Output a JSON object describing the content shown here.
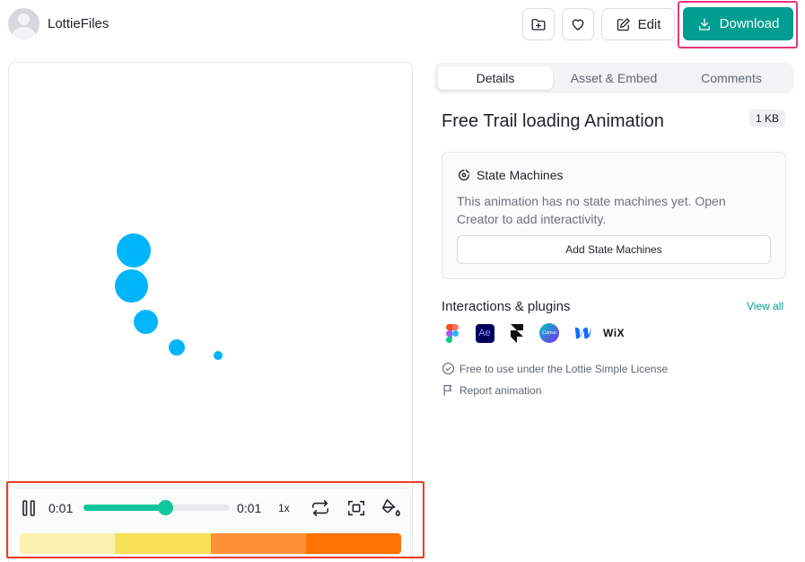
{
  "header": {
    "username": "LottieFiles",
    "edit_label": "Edit",
    "download_label": "Download"
  },
  "player": {
    "current_time": "0:01",
    "total_time": "0:01",
    "speed": "1x",
    "progress": 0.56,
    "segment_colors": [
      "#fdf1b0",
      "#f8e055",
      "#fe9138",
      "#ff7203"
    ]
  },
  "tabs": [
    {
      "label": "Details",
      "active": true
    },
    {
      "label": "Asset & Embed",
      "active": false
    },
    {
      "label": "Comments",
      "active": false
    }
  ],
  "details": {
    "title": "Free Trail loading Animation",
    "size": "1 KB",
    "state_machines": {
      "title": "State Machines",
      "description": "This animation has no state machines yet. Open Creator to add interactivity.",
      "button_label": "Add State Machines"
    },
    "plugins": {
      "title": "Interactions & plugins",
      "view_all": "View all",
      "items": [
        {
          "icon": "figma-icon"
        },
        {
          "icon": "after-effects-icon",
          "text": "Ae"
        },
        {
          "icon": "framer-icon"
        },
        {
          "icon": "canva-icon",
          "text": "Canva"
        },
        {
          "icon": "webflow-icon"
        },
        {
          "icon": "wix-icon",
          "text": "WiX"
        }
      ]
    },
    "license": "Free to use under the Lottie Simple License",
    "report": "Report animation"
  },
  "colors": {
    "accent": "#019d91",
    "animation_dot": "#00b6f9",
    "scrubber": "#11c59a"
  }
}
